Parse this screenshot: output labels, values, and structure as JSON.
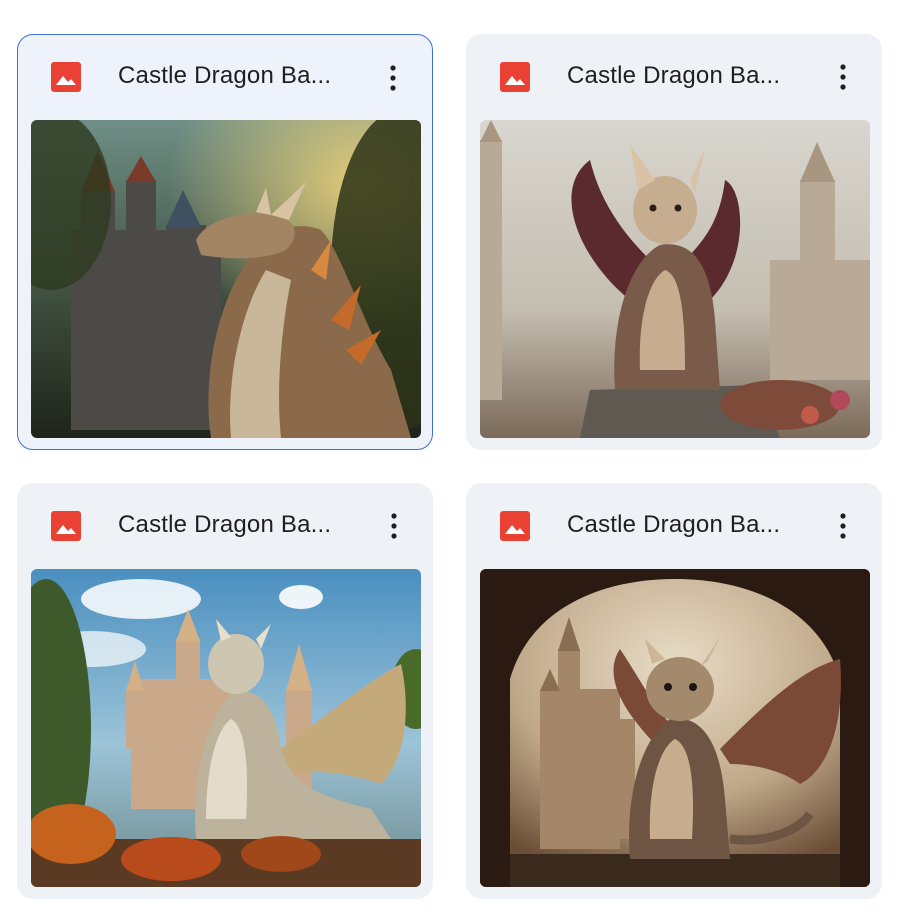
{
  "files": [
    {
      "name": "Castle Dragon Ba...",
      "selected": true,
      "thumbnail": "dragon-forest-castle"
    },
    {
      "name": "Castle Dragon Ba...",
      "selected": false,
      "thumbnail": "dragon-winged-cliff"
    },
    {
      "name": "Castle Dragon Ba...",
      "selected": false,
      "thumbnail": "dragon-blue-sky-castle"
    },
    {
      "name": "Castle Dragon Ba...",
      "selected": false,
      "thumbnail": "dragon-archway-castle"
    }
  ],
  "icons": {
    "file_type": "image-file-icon",
    "more": "more-vert-icon"
  },
  "colors": {
    "image_icon_red": "#e94235",
    "selected_border": "#3d6fd8",
    "card_bg": "#eef1f6"
  }
}
